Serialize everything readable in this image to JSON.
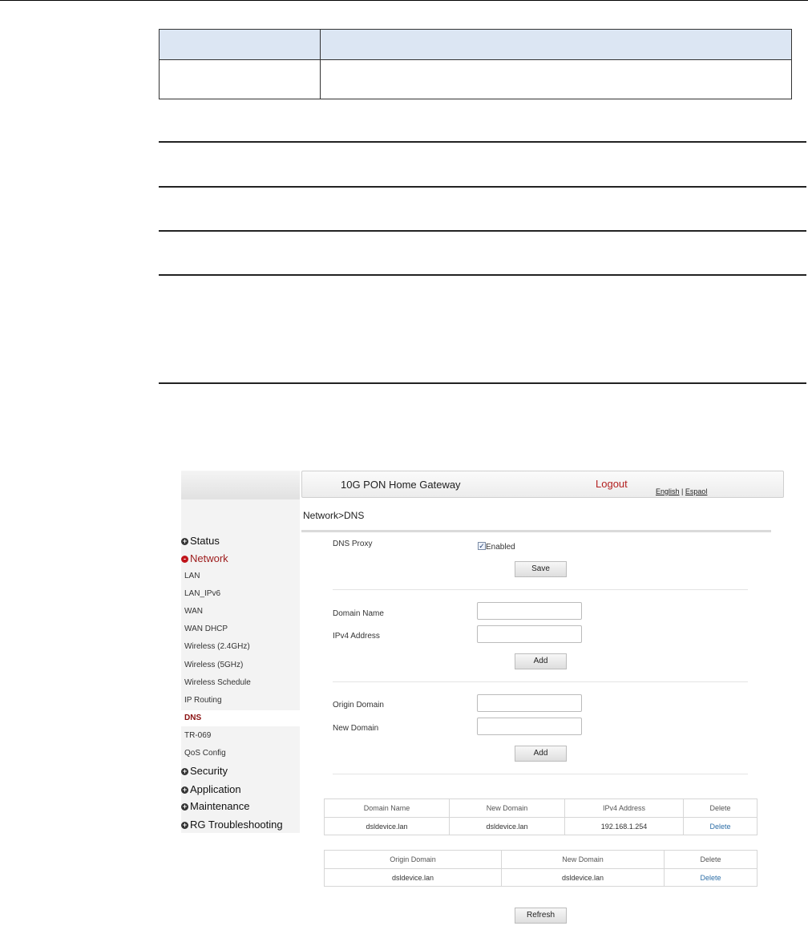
{
  "header": {
    "title": "10G PON Home Gateway",
    "logout": "Logout",
    "lang_english": "English",
    "lang_separator": "|",
    "lang_espanol": "Espaol"
  },
  "breadcrumb": "Network>DNS",
  "sidebar": {
    "groups_before": [
      {
        "label": "Status",
        "marker": "+"
      },
      {
        "label": "Network",
        "marker": "-",
        "active": true
      }
    ],
    "sub_items": [
      "LAN",
      "LAN_IPv6",
      "WAN",
      "WAN DHCP",
      "Wireless (2.4GHz)",
      "Wireless (5GHz)",
      "Wireless Schedule",
      "IP Routing",
      "DNS",
      "TR-069",
      "QoS Config"
    ],
    "selected_sub_item": "DNS",
    "groups_after": [
      {
        "label": "Security",
        "marker": "+"
      },
      {
        "label": "Application",
        "marker": "+"
      },
      {
        "label": "Maintenance",
        "marker": "+"
      },
      {
        "label": "RG Troubleshooting",
        "marker": "+"
      }
    ]
  },
  "dns_proxy": {
    "label": "DNS Proxy",
    "checked": true,
    "checkbox_label": "Enabled",
    "save_label": "Save"
  },
  "host_form": {
    "domain_name_label": "Domain Name",
    "domain_name_value": "",
    "ipv4_label": "IPv4 Address",
    "ipv4_value": "",
    "add_label": "Add"
  },
  "rewrite_form": {
    "origin_label": "Origin Domain",
    "origin_value": "",
    "new_label": "New Domain",
    "new_value": "",
    "add_label": "Add"
  },
  "host_table": {
    "headers": [
      "Domain Name",
      "New Domain",
      "IPv4 Address",
      "Delete"
    ],
    "rows": [
      [
        "dsldevice.lan",
        "dsldevice.lan",
        "192.168.1.254",
        "Delete"
      ]
    ]
  },
  "rewrite_table": {
    "headers": [
      "Origin Domain",
      "New Domain",
      "Delete"
    ],
    "rows": [
      [
        "dsldevice.lan",
        "dsldevice.lan",
        "Delete"
      ]
    ]
  },
  "refresh_label": "Refresh",
  "colors": {
    "accent_red": "#b32020",
    "link_blue": "#2e6fa7",
    "table_header_blue": "#dce6f3"
  }
}
